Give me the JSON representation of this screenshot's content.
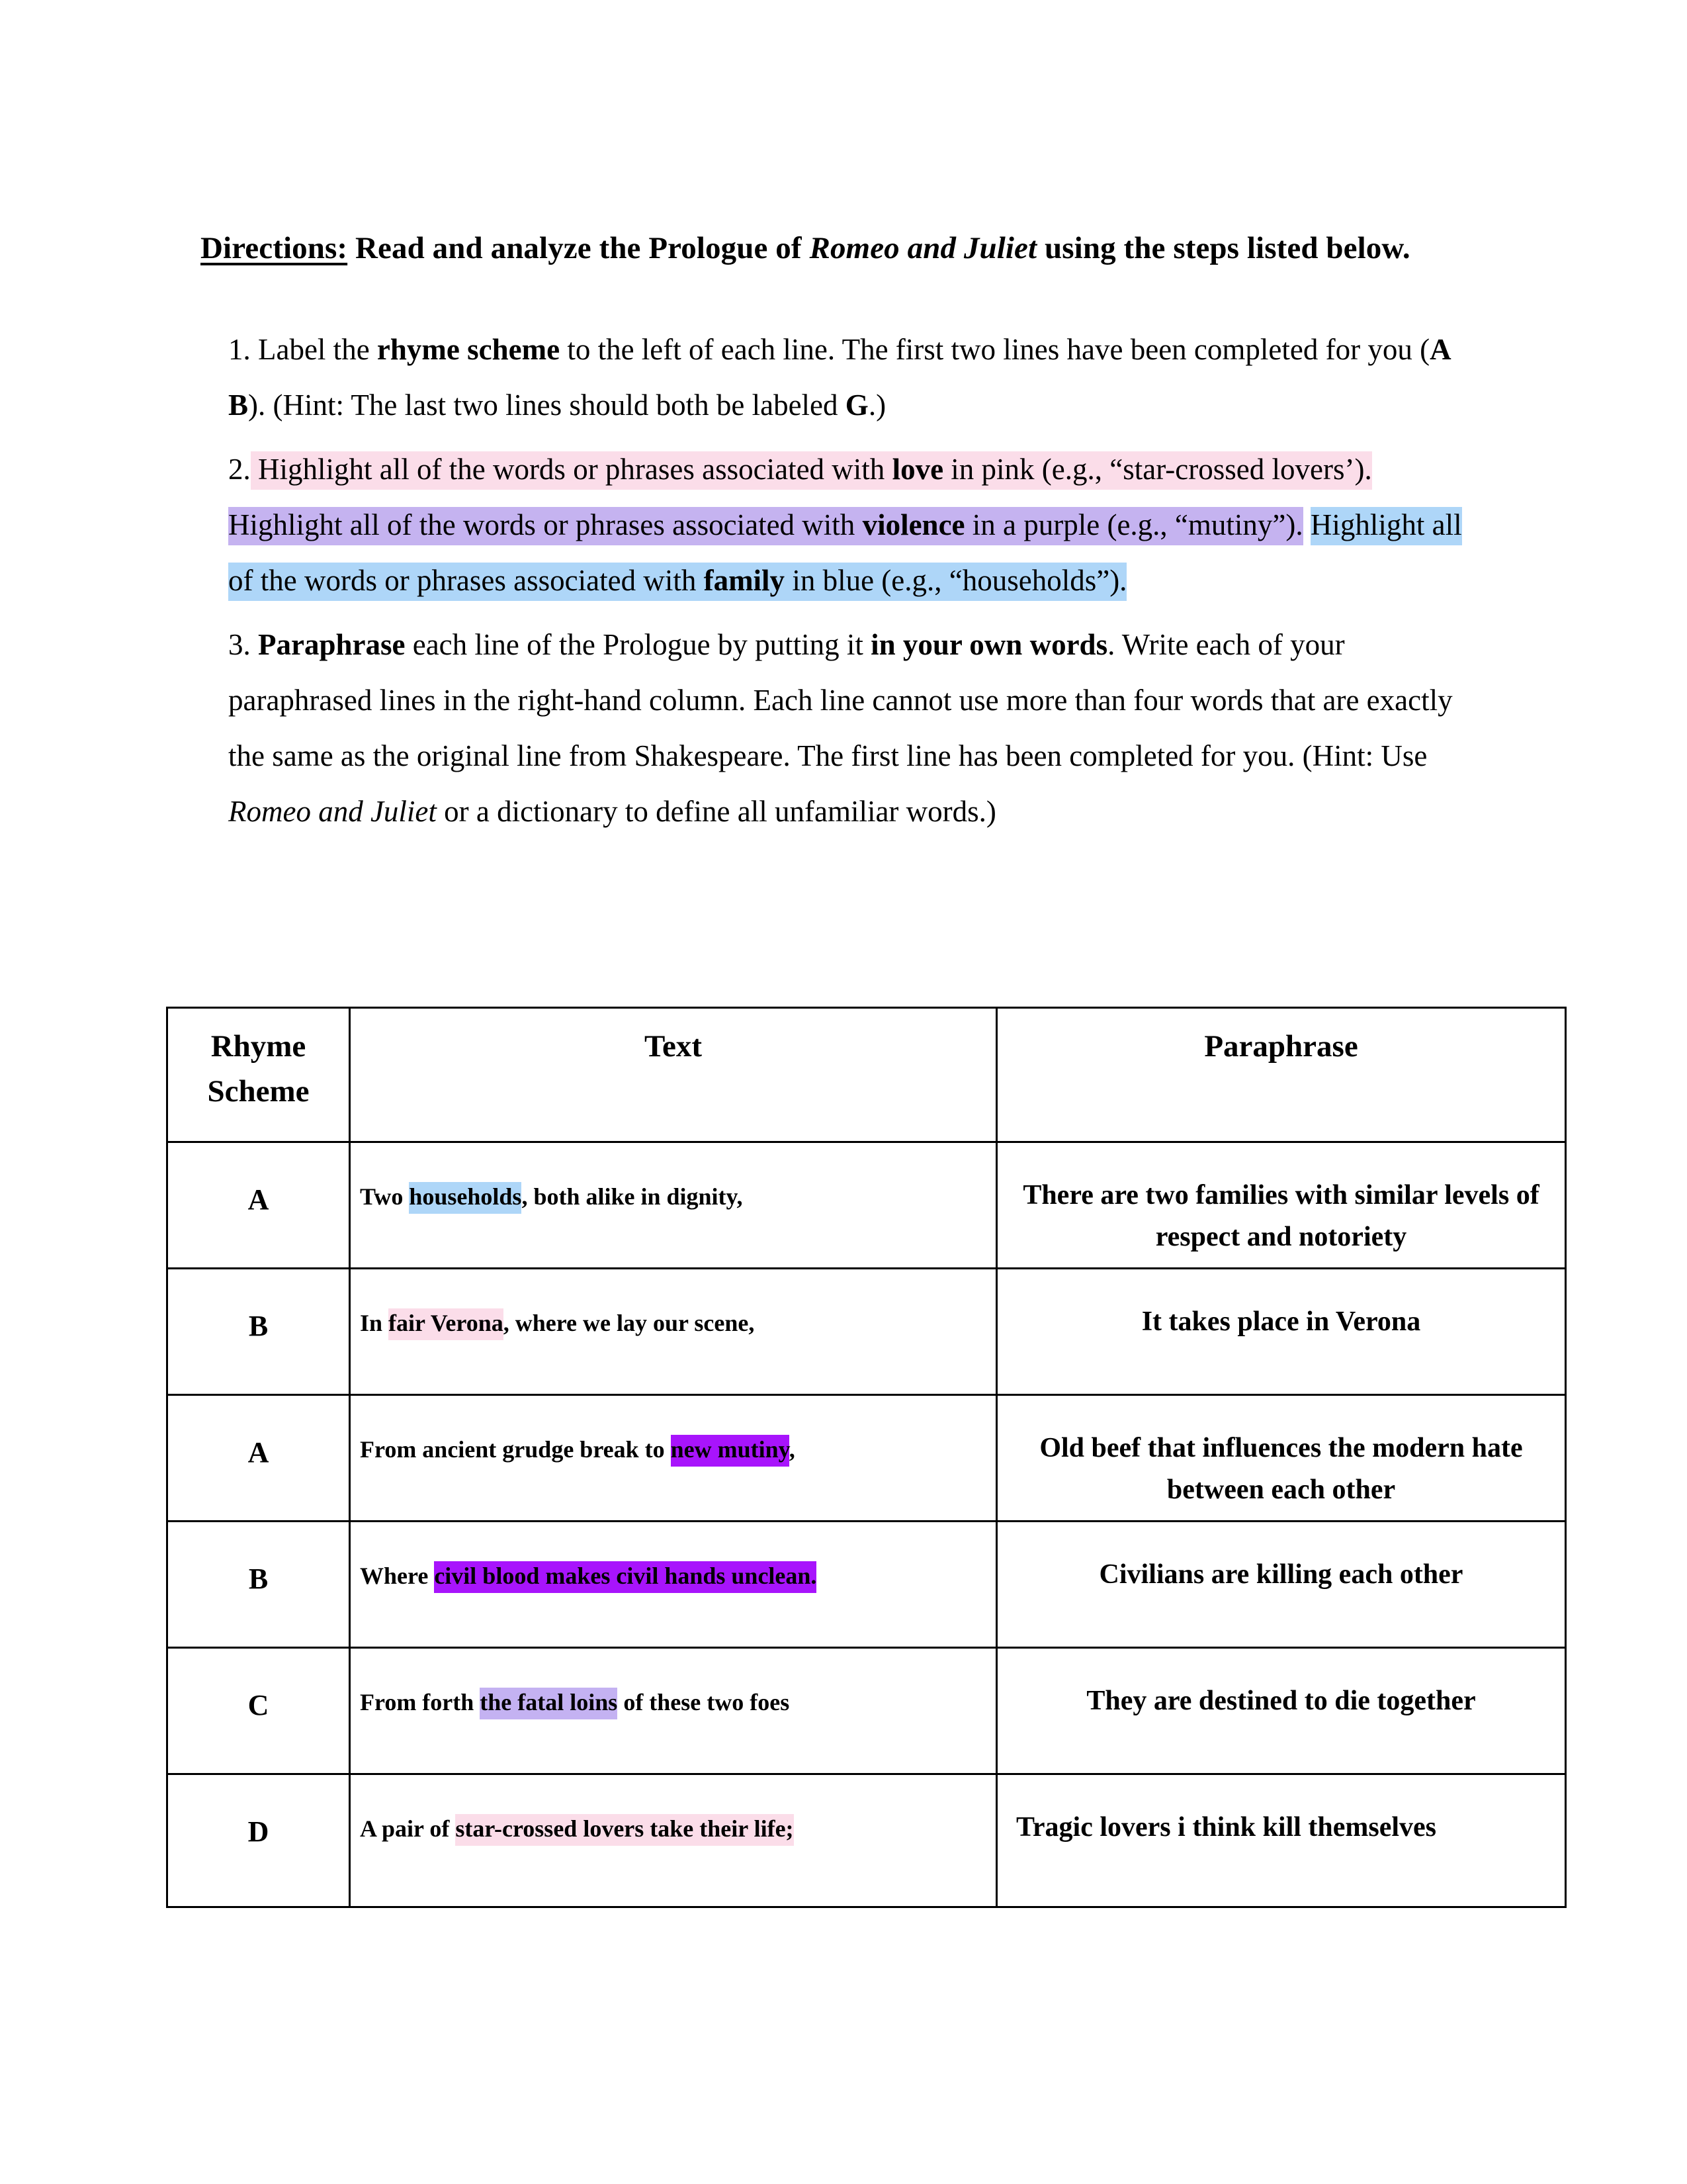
{
  "directions": {
    "label": "Directions:",
    "text_before_title": " Read and analyze the Prologue of ",
    "title": "Romeo and Juliet",
    "text_after_title": " using the steps listed below."
  },
  "steps": [
    {
      "number": "1.",
      "segments": [
        {
          "text": " Label the ",
          "style": "normal",
          "highlight": "none"
        },
        {
          "text": "rhyme scheme",
          "style": "bold",
          "highlight": "none"
        },
        {
          "text": " to the left of each line.  The first two lines have been completed for you (",
          "style": "normal",
          "highlight": "none"
        },
        {
          "text": "A B",
          "style": "bold",
          "highlight": "none"
        },
        {
          "text": ").  (Hint: The last two lines should both be labeled ",
          "style": "normal",
          "highlight": "none"
        },
        {
          "text": "G",
          "style": "bold",
          "highlight": "none"
        },
        {
          "text": ".)",
          "style": "normal",
          "highlight": "none"
        }
      ]
    },
    {
      "number": "2.",
      "segments": [
        {
          "text": " Highlight all of the words or phrases associated with ",
          "style": "normal",
          "highlight": "pink"
        },
        {
          "text": "love",
          "style": "bold",
          "highlight": "pink"
        },
        {
          "text": " in pink (e.g., “star-crossed lovers’).",
          "style": "normal",
          "highlight": "pink"
        },
        {
          "text": "  ",
          "style": "normal",
          "highlight": "none"
        },
        {
          "text": "Highlight all of the words or phrases associated with ",
          "style": "normal",
          "highlight": "purple"
        },
        {
          "text": "violence",
          "style": "bold",
          "highlight": "purple"
        },
        {
          "text": " in a purple (e.g., “mutiny”).",
          "style": "normal",
          "highlight": "purple"
        },
        {
          "text": " ",
          "style": "normal",
          "highlight": "none"
        },
        {
          "text": "Highlight all of the words or phrases associated with ",
          "style": "normal",
          "highlight": "blue"
        },
        {
          "text": "family",
          "style": "bold",
          "highlight": "blue"
        },
        {
          "text": " in blue (e.g., “households”).",
          "style": "normal",
          "highlight": "blue"
        }
      ]
    },
    {
      "number": "3.",
      "segments": [
        {
          "text": " ",
          "style": "normal",
          "highlight": "none"
        },
        {
          "text": "Paraphrase",
          "style": "bold",
          "highlight": "none"
        },
        {
          "text": " each line of the Prologue by putting it ",
          "style": "normal",
          "highlight": "none"
        },
        {
          "text": "in your own words",
          "style": "bold",
          "highlight": "none"
        },
        {
          "text": ".  Write each of your paraphrased lines in the right-hand column.  Each line cannot use more than four words that are exactly the same as the original line from Shakespeare.  The first line has been completed for you.  (Hint: Use ",
          "style": "normal",
          "highlight": "none"
        },
        {
          "text": "Romeo and Juliet",
          "style": "italic",
          "highlight": "none"
        },
        {
          "text": " or a dictionary to define all unfamiliar words.)",
          "style": "normal",
          "highlight": "none"
        }
      ]
    }
  ],
  "table": {
    "headers": {
      "rhyme_scheme": "Rhyme Scheme",
      "rhyme_scheme_line1": "Rhyme",
      "rhyme_scheme_line2": "Scheme",
      "text": "Text",
      "paraphrase": "Paraphrase"
    },
    "rows": [
      {
        "rhyme": "A",
        "text_segments": [
          {
            "text": "Two ",
            "highlight": "none"
          },
          {
            "text": "households",
            "highlight": "blue"
          },
          {
            "text": ", both alike in dignity,",
            "highlight": "none"
          }
        ],
        "paraphrase": "There are two families with similar levels of respect and notoriety",
        "paraphrase_align": "center"
      },
      {
        "rhyme": "B",
        "text_segments": [
          {
            "text": "In ",
            "highlight": "none"
          },
          {
            "text": "fair Verona",
            "highlight": "pink"
          },
          {
            "text": ", where we lay our scene,",
            "highlight": "none"
          }
        ],
        "paraphrase": "It takes place in Verona",
        "paraphrase_align": "center"
      },
      {
        "rhyme": "A",
        "text_segments": [
          {
            "text": "From ancient grudge break to ",
            "highlight": "none"
          },
          {
            "text": "new mutiny",
            "highlight": "vivid"
          },
          {
            "text": ",",
            "highlight": "none"
          }
        ],
        "paraphrase": "Old beef that influences the modern hate between each other",
        "paraphrase_align": "center"
      },
      {
        "rhyme": "B",
        "text_segments": [
          {
            "text": "Where ",
            "highlight": "none"
          },
          {
            "text": "civil blood makes civil hands unclean.",
            "highlight": "vivid"
          }
        ],
        "paraphrase": "Civilians are killing each other",
        "paraphrase_align": "center"
      },
      {
        "rhyme": "C",
        "text_segments": [
          {
            "text": "From forth ",
            "highlight": "none"
          },
          {
            "text": "the fatal loins",
            "highlight": "lavender"
          },
          {
            "text": " of these two foes",
            "highlight": "none"
          }
        ],
        "paraphrase": "They are destined to die together",
        "paraphrase_align": "center"
      },
      {
        "rhyme": "D",
        "text_segments": [
          {
            "text": "A pair of ",
            "highlight": "none"
          },
          {
            "text": "star-crossed lovers take their life;",
            "highlight": "pink"
          }
        ],
        "paraphrase": "Tragic lovers i think kill themselves",
        "paraphrase_align": "left"
      }
    ]
  },
  "colors": {
    "pink": "#fbdde9",
    "purple": "#c5b3f0",
    "blue": "#aed6f8",
    "vivid_purple": "#a814fc",
    "lavender": "#c4b2f2",
    "text": "#000000",
    "border": "#000000",
    "background": "#ffffff"
  }
}
